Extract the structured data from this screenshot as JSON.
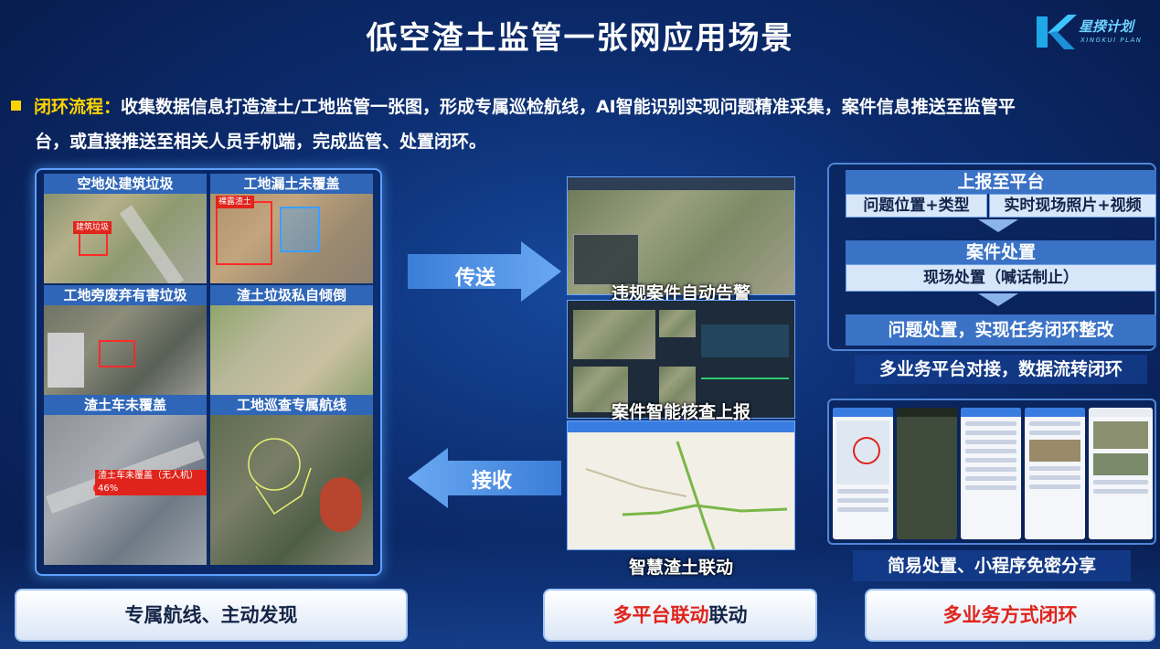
{
  "page": {
    "title": "低空渣土监管一张网应用场景"
  },
  "logo": {
    "name_cn": "星揆计划",
    "name_en": "XINGKUI PLAN"
  },
  "intro": {
    "keyword": "闭环流程：",
    "line1": "收集数据信息打造渣土/工地监管一张图，形成专属巡检航线，AI智能识别实现问题精准采集，案件信息推送至监管平",
    "line2": "台，或直接推送至相关人员手机端，完成监管、处置闭环。"
  },
  "scenes": [
    {
      "caption": "空地处建筑垃圾",
      "tag": "建筑垃圾"
    },
    {
      "caption": "工地漏土未覆盖",
      "tag": "裸露渣土"
    },
    {
      "caption": "工地旁废弃有害垃圾",
      "tag": ""
    },
    {
      "caption": "渣土垃圾私自倾倒",
      "tag": ""
    },
    {
      "caption": "渣土车未覆盖",
      "tag": "渣土车未覆盖（无人机）46%"
    },
    {
      "caption": "工地巡查专属航线",
      "tag": ""
    }
  ],
  "arrows": {
    "send": "传送",
    "receive": "接收"
  },
  "middle": {
    "caption1": "违规案件自动告警",
    "caption2": "案件智能核查上报",
    "caption3": "智慧渣土联动"
  },
  "flow": {
    "report": "上报至平台",
    "report_item1": "问题位置+类型",
    "report_item2": "实时现场照片+视频",
    "case": "案件处置",
    "case_item": "现场处置（喊话制止）",
    "close": "问题处置，实现任务闭环整改",
    "caption": "多业务平台对接，数据流转闭环"
  },
  "phones": {
    "caption": "简易处置、小程序免密分享"
  },
  "cards": {
    "card1": "专属航线、主动发现",
    "card2_red": "多平台联动",
    "card2_rest": "联动",
    "card3": "多业务方式闭环"
  },
  "colors": {
    "accent_yellow": "#ffd400",
    "highlight_red": "#e0241c",
    "panel_blue": "#3a72c6"
  }
}
